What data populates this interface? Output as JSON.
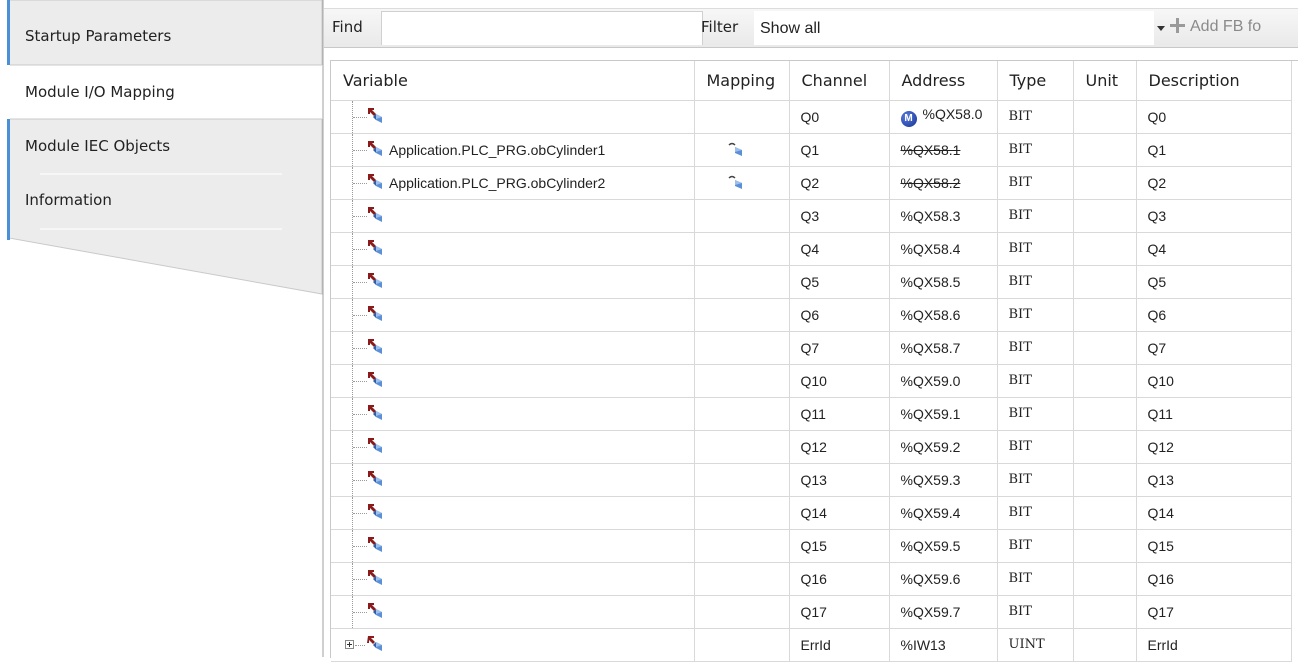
{
  "tabs": [
    {
      "label": "Startup Parameters",
      "active": false
    },
    {
      "label": "Module I/O Mapping",
      "active": true
    },
    {
      "label": "Module IEC Objects",
      "active": false
    },
    {
      "label": "Information",
      "active": false
    }
  ],
  "toolbar": {
    "find_label": "Find",
    "find_value": "",
    "filter_label": "Filter",
    "filter_value": "Show all",
    "add_fb_label": "Add FB fo"
  },
  "columns": [
    "Variable",
    "Mapping",
    "Channel",
    "Address",
    "Type",
    "Unit",
    "Description"
  ],
  "rows": [
    {
      "variable": "",
      "mapping": false,
      "channel": "Q0",
      "address": "%QX58.0",
      "address_badge": "M",
      "address_struck": false,
      "type": "BIT",
      "unit": "",
      "description": "Q0"
    },
    {
      "variable": "Application.PLC_PRG.obCylinder1",
      "mapping": true,
      "channel": "Q1",
      "address": "%QX58.1",
      "address_struck": true,
      "type": "BIT",
      "unit": "",
      "description": "Q1"
    },
    {
      "variable": "Application.PLC_PRG.obCylinder2",
      "mapping": true,
      "channel": "Q2",
      "address": "%QX58.2",
      "address_struck": true,
      "type": "BIT",
      "unit": "",
      "description": "Q2"
    },
    {
      "variable": "",
      "mapping": false,
      "channel": "Q3",
      "address": "%QX58.3",
      "address_struck": false,
      "type": "BIT",
      "unit": "",
      "description": "Q3"
    },
    {
      "variable": "",
      "mapping": false,
      "channel": "Q4",
      "address": "%QX58.4",
      "address_struck": false,
      "type": "BIT",
      "unit": "",
      "description": "Q4"
    },
    {
      "variable": "",
      "mapping": false,
      "channel": "Q5",
      "address": "%QX58.5",
      "address_struck": false,
      "type": "BIT",
      "unit": "",
      "description": "Q5"
    },
    {
      "variable": "",
      "mapping": false,
      "channel": "Q6",
      "address": "%QX58.6",
      "address_struck": false,
      "type": "BIT",
      "unit": "",
      "description": "Q6"
    },
    {
      "variable": "",
      "mapping": false,
      "channel": "Q7",
      "address": "%QX58.7",
      "address_struck": false,
      "type": "BIT",
      "unit": "",
      "description": "Q7"
    },
    {
      "variable": "",
      "mapping": false,
      "channel": "Q10",
      "address": "%QX59.0",
      "address_struck": false,
      "type": "BIT",
      "unit": "",
      "description": "Q10"
    },
    {
      "variable": "",
      "mapping": false,
      "channel": "Q11",
      "address": "%QX59.1",
      "address_struck": false,
      "type": "BIT",
      "unit": "",
      "description": "Q11"
    },
    {
      "variable": "",
      "mapping": false,
      "channel": "Q12",
      "address": "%QX59.2",
      "address_struck": false,
      "type": "BIT",
      "unit": "",
      "description": "Q12"
    },
    {
      "variable": "",
      "mapping": false,
      "channel": "Q13",
      "address": "%QX59.3",
      "address_struck": false,
      "type": "BIT",
      "unit": "",
      "description": "Q13"
    },
    {
      "variable": "",
      "mapping": false,
      "channel": "Q14",
      "address": "%QX59.4",
      "address_struck": false,
      "type": "BIT",
      "unit": "",
      "description": "Q14"
    },
    {
      "variable": "",
      "mapping": false,
      "channel": "Q15",
      "address": "%QX59.5",
      "address_struck": false,
      "type": "BIT",
      "unit": "",
      "description": "Q15"
    },
    {
      "variable": "",
      "mapping": false,
      "channel": "Q16",
      "address": "%QX59.6",
      "address_struck": false,
      "type": "BIT",
      "unit": "",
      "description": "Q16"
    },
    {
      "variable": "",
      "mapping": false,
      "channel": "Q17",
      "address": "%QX59.7",
      "address_struck": false,
      "type": "BIT",
      "unit": "",
      "description": "Q17"
    },
    {
      "variable": "",
      "mapping": false,
      "expandable": true,
      "channel": "ErrId",
      "address": "%IW13",
      "address_struck": false,
      "type": "UINT",
      "unit": "",
      "description": "ErrId"
    }
  ],
  "colors": {
    "badge": "#1f3fa8",
    "tab_active_bg": "#ffffff",
    "tab_inactive_bg": "#ececec",
    "accent": "#4a90d9"
  }
}
